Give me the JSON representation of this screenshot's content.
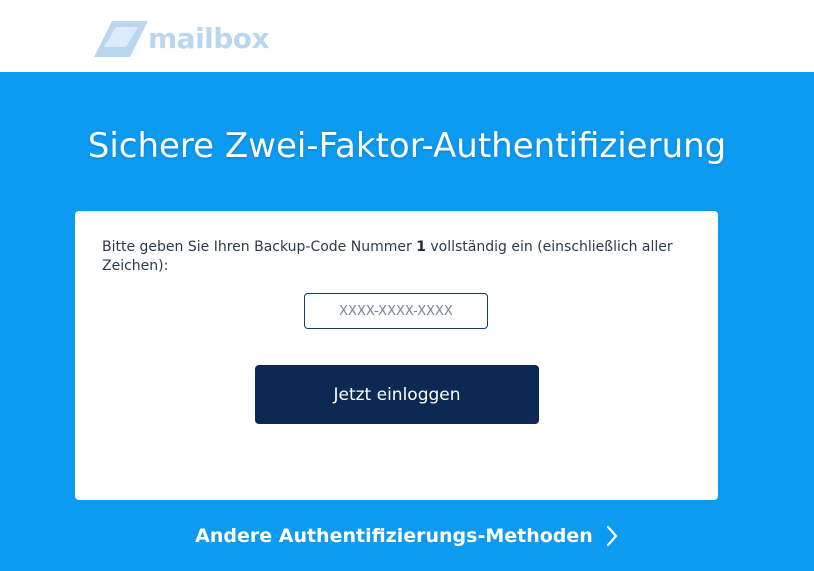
{
  "header": {
    "logo_text": "mailbox"
  },
  "page": {
    "title": "Sichere Zwei-Faktor-Authentifizierung"
  },
  "form": {
    "instruction_before": "Bitte geben Sie Ihren Backup-Code Nummer ",
    "code_number": "1",
    "instruction_after": " vollständig ein (einschließlich aller Zeichen):",
    "code_placeholder": "XXXX-XXXX-XXXX",
    "code_value": "",
    "submit_label": "Jetzt einloggen"
  },
  "footer": {
    "alt_methods_label": "Andere Authentifizierungs-Methoden",
    "alt_methods_icon": "chevron-right-icon"
  },
  "colors": {
    "background": "#0d9bf2",
    "button": "#0b2952",
    "card": "#ffffff"
  }
}
